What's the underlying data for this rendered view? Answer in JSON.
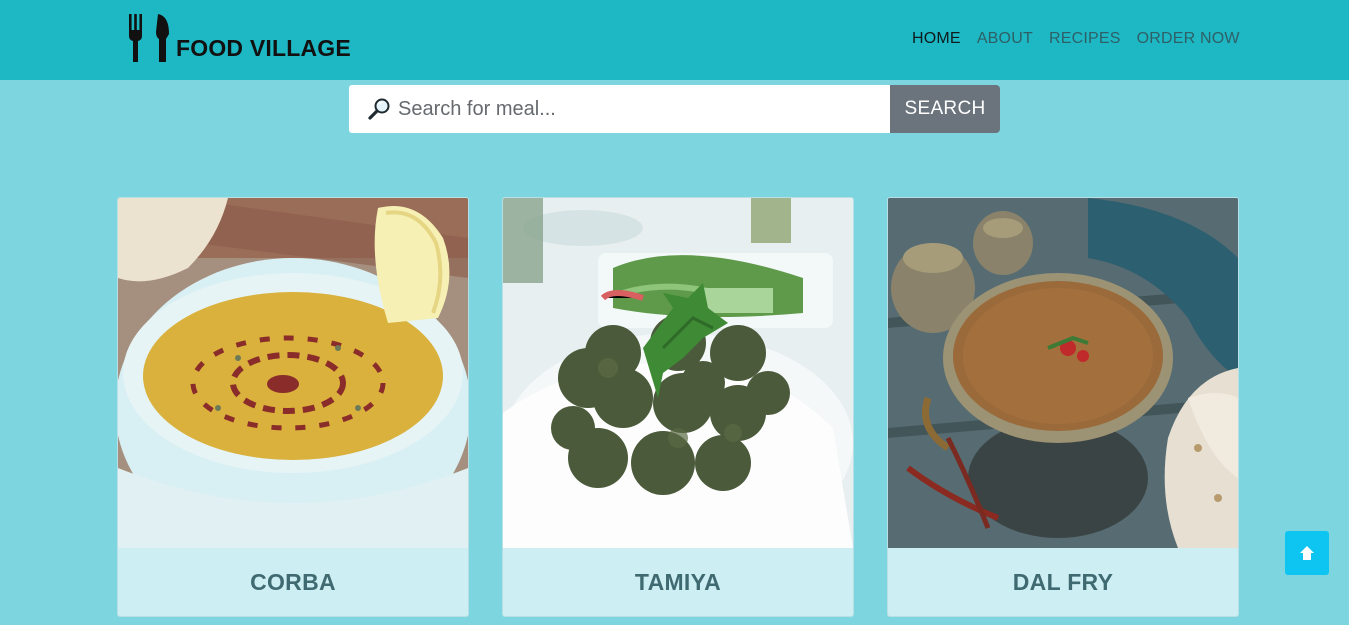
{
  "brand": {
    "name": "FOOD VILLAGE",
    "icon": "fork-knife-icon"
  },
  "nav": {
    "items": [
      {
        "label": "HOME",
        "active": true
      },
      {
        "label": "ABOUT",
        "active": false
      },
      {
        "label": "RECIPES",
        "active": false
      },
      {
        "label": "ORDER NOW",
        "active": false
      }
    ]
  },
  "search": {
    "placeholder": "Search for meal...",
    "value": "",
    "button_label": "SEARCH",
    "icon": "magnifier-icon"
  },
  "meals": [
    {
      "title": "CORBA",
      "image": "lentil-soup-bowl"
    },
    {
      "title": "TAMIYA",
      "image": "falafel-plate"
    },
    {
      "title": "DAL FRY",
      "image": "dal-curry-bowl"
    }
  ],
  "scroll_top": {
    "icon": "arrow-up-icon"
  },
  "colors": {
    "navbar": "#1db8c4",
    "background": "#7dd6df",
    "card_footer": "#cdeef2",
    "search_button": "#6b737d",
    "scroll_button": "#0dc5f0"
  }
}
